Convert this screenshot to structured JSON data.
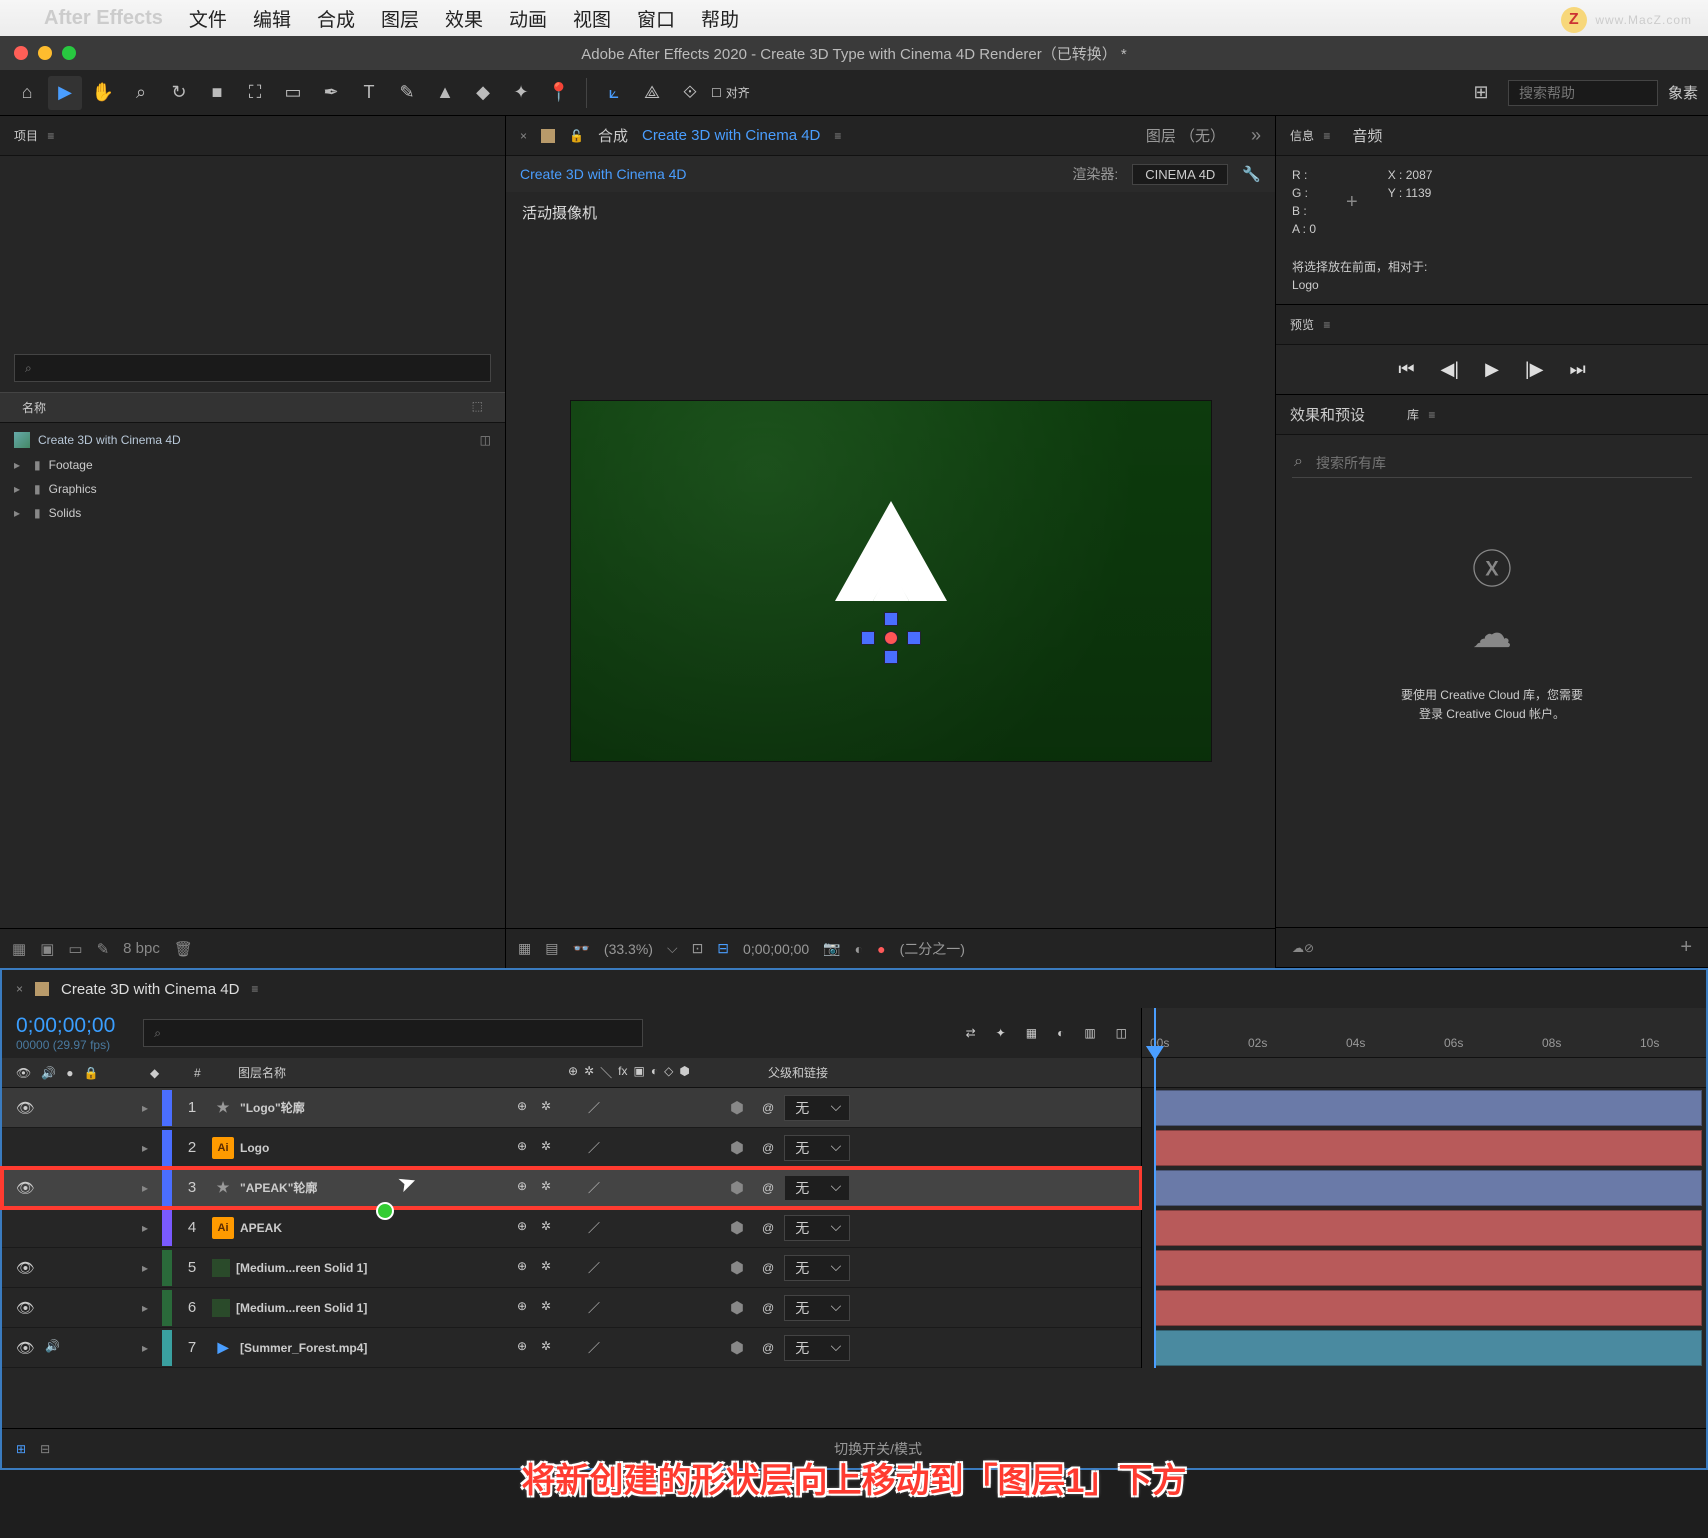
{
  "menubar": {
    "app": "After Effects",
    "items": [
      "文件",
      "编辑",
      "合成",
      "图层",
      "效果",
      "动画",
      "视图",
      "窗口",
      "帮助"
    ]
  },
  "watermark": "www.MacZ.com",
  "window_title": "Adobe After Effects 2020 - Create 3D Type with Cinema 4D Renderer（已转换） *",
  "toolbar": {
    "align": "对齐",
    "search_placeholder": "搜索帮助",
    "pixel": "象素"
  },
  "project": {
    "tab": "项目",
    "search_placeholder": "",
    "col_name": "名称",
    "items": [
      {
        "type": "comp",
        "name": "Create 3D with Cinema 4D"
      },
      {
        "type": "folder",
        "name": "Footage"
      },
      {
        "type": "folder",
        "name": "Graphics"
      },
      {
        "type": "folder",
        "name": "Solids"
      }
    ],
    "bpc": "8 bpc"
  },
  "viewer": {
    "comp_prefix": "合成",
    "comp_name": "Create 3D with Cinema 4D",
    "layer_none": "图层 （无）",
    "render_label": "渲染器:",
    "render_value": "CINEMA 4D",
    "active_cam": "活动摄像机",
    "zoom": "(33.3%)",
    "timecode": "0;00;00;00",
    "half": "(二分之一)"
  },
  "info": {
    "tab_info": "信息",
    "tab_audio": "音频",
    "r": "R :",
    "g": "G :",
    "b": "B :",
    "a": "A :  0",
    "x": "X : 2087",
    "y": "Y : 1139",
    "selection": "将选择放在前面，相对于:\nLogo"
  },
  "preview": {
    "tab": "预览"
  },
  "lib": {
    "tab_fx": "效果和预设",
    "tab_lib": "库",
    "search_placeholder": "搜索所有库",
    "cc_text1": "要使用 Creative Cloud 库，您需要",
    "cc_text2": "登录 Creative Cloud 帐户。"
  },
  "timeline": {
    "comp_name": "Create 3D with Cinema 4D",
    "timecode": "0;00;00;00",
    "timecode_sub": "00000 (29.97 fps)",
    "ruler": [
      "00s",
      "02s",
      "04s",
      "06s",
      "08s",
      "10s"
    ],
    "col_layer": "图层名称",
    "col_parent": "父级和链接",
    "col_num": "#",
    "parent_none": "无",
    "toggle": "切换开关/模式",
    "layers": [
      {
        "num": "1",
        "name": "\"Logo\"轮廓",
        "color": "#4a6eff",
        "ico": "star",
        "bold": true,
        "bar": "#6a7aa8",
        "vis": true,
        "snd": false
      },
      {
        "num": "2",
        "name": "Logo",
        "color": "#4a6eff",
        "ico": "ai",
        "bold": true,
        "bar": "#b85a5a",
        "vis": false,
        "snd": false
      },
      {
        "num": "3",
        "name": "\"APEAK\"轮廓",
        "color": "#4a6eff",
        "ico": "star",
        "bold": true,
        "bar": "#6a7aa8",
        "hl": true,
        "vis": true,
        "snd": false
      },
      {
        "num": "4",
        "name": "APEAK",
        "color": "#7a5aff",
        "ico": "ai",
        "bold": true,
        "bar": "#b85a5a",
        "vis": false,
        "snd": false
      },
      {
        "num": "5",
        "name": "[Medium...reen Solid 1]",
        "color": "#2a6a3a",
        "ico": "solid",
        "bold": true,
        "bar": "#b85a5a",
        "vis": true,
        "snd": false
      },
      {
        "num": "6",
        "name": "[Medium...reen Solid 1]",
        "color": "#2a6a3a",
        "ico": "solid",
        "bold": true,
        "bar": "#b85a5a",
        "vis": true,
        "snd": false
      },
      {
        "num": "7",
        "name": "[Summer_Forest.mp4]",
        "color": "#3aa0a0",
        "ico": "vid",
        "bold": true,
        "bar": "#4a8aa0",
        "vis": true,
        "snd": true
      }
    ]
  },
  "caption": "将新创建的形状层向上移动到「图层1」下方"
}
